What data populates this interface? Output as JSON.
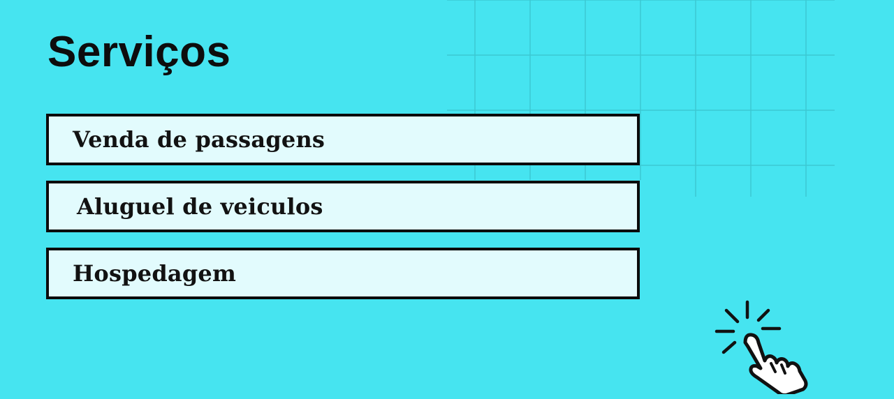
{
  "page": {
    "title": "Serviços",
    "background_color": "#46e4f0",
    "box_color": "#e2fbfd",
    "border_color": "#0b0b0b"
  },
  "services": [
    {
      "label": "Venda de passagens"
    },
    {
      "label": "Aluguel de veiculos"
    },
    {
      "label": "Hospedagem"
    }
  ],
  "decorations": {
    "pointer_icon": "click-hand-icon",
    "grid": "background-grid"
  }
}
